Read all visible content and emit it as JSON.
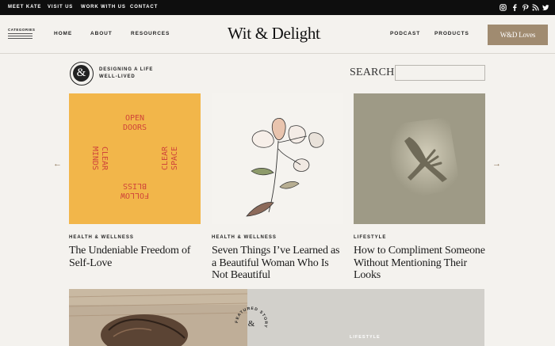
{
  "topbar": {
    "links": [
      "MEET KATE",
      "VISIT US",
      "WORK WITH US",
      "CONTACT"
    ],
    "social_icons": [
      "instagram-icon",
      "facebook-icon",
      "pinterest-icon",
      "rss-icon",
      "twitter-icon"
    ]
  },
  "header": {
    "categories_label": "CATEGORIES",
    "nav_left": [
      "HOME",
      "ABOUT",
      "RESOURCES"
    ],
    "logo": "Wit & Delight",
    "logo_dot": ".",
    "nav_right": [
      "PODCAST",
      "PRODUCTS"
    ],
    "loves_button": "W&D Loves"
  },
  "intro": {
    "badge_glyph": "&",
    "tagline": "DESIGNING A LIFE WELL-LIVED",
    "search_label": "SEARCH",
    "search_value": ""
  },
  "carousel": {
    "prev_arrow": "←",
    "next_arrow": "→",
    "card1_art": {
      "top": "OPEN DOORS",
      "left": "CLEAR MINDS",
      "right": "CLEAR SPACE",
      "bottom": "FOLLOW BLISS"
    },
    "cards": [
      {
        "category": "HEALTH & WELLNESS",
        "title": "The Undeniable Freedom of Self-Love"
      },
      {
        "category": "HEALTH & WELLNESS",
        "title": "Seven Things I’ve Learned as a Beautiful Woman Who Is Not Beautiful"
      },
      {
        "category": "LIFESTYLE",
        "title": "How to Compliment Someone Without Mentioning Their Looks"
      }
    ]
  },
  "featured": {
    "stamp": "FEATURED STORY",
    "category": "LIFESTYLE"
  },
  "colors": {
    "background": "#f4f2ee",
    "topbar": "#0e0e0e",
    "accent": "#a08b70",
    "card1_bg": "#f2b64a",
    "card1_text": "#d0463a"
  }
}
